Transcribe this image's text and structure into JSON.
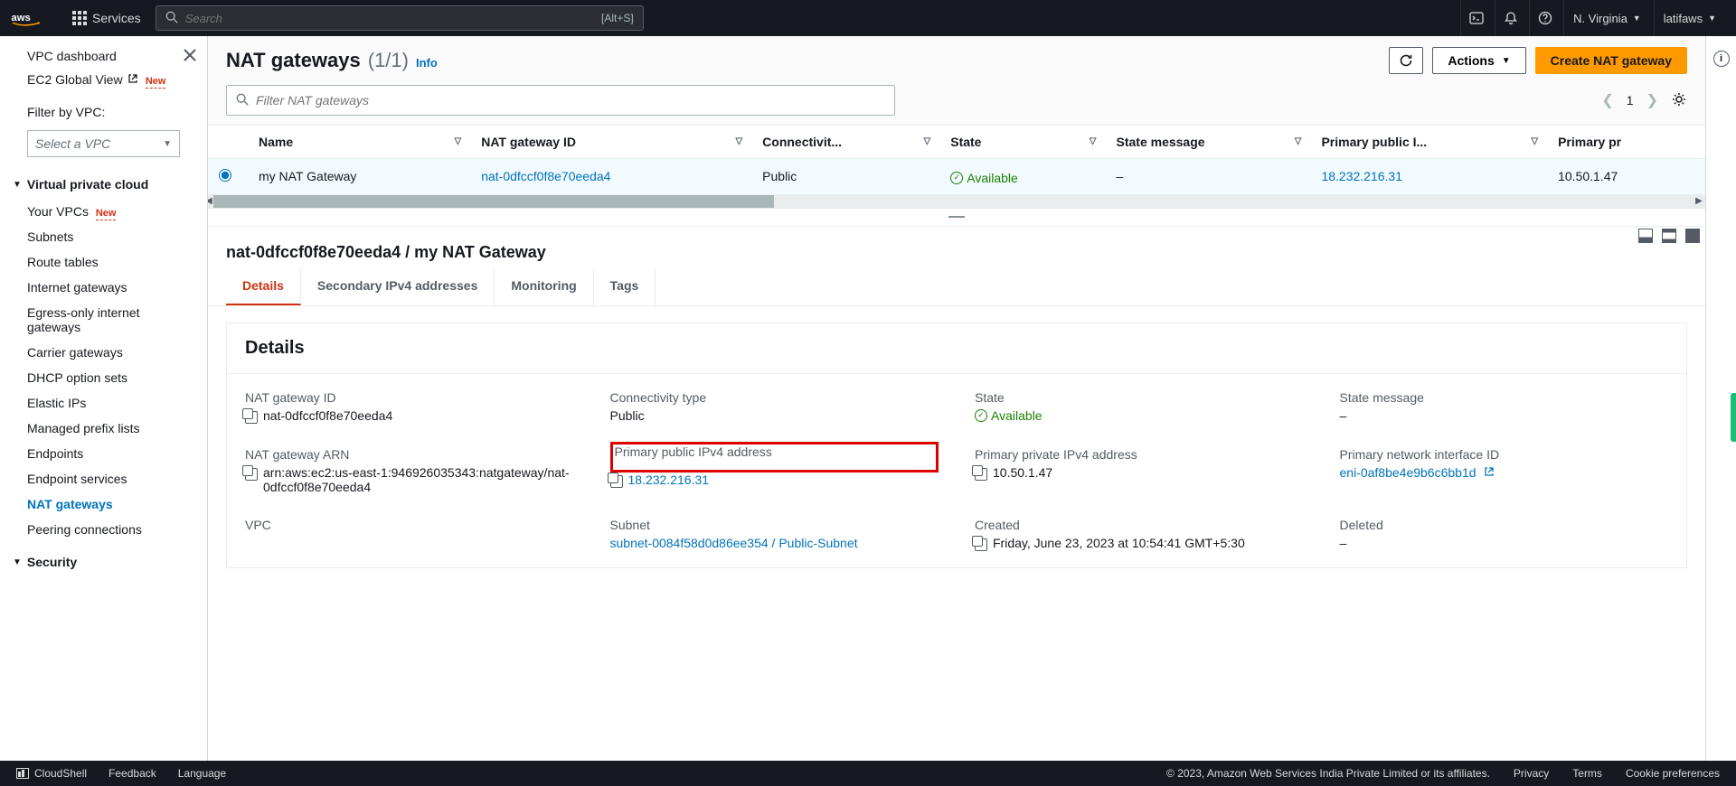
{
  "topbar": {
    "services": "Services",
    "search_placeholder": "Search",
    "search_kbd": "[Alt+S]",
    "region": "N. Virginia",
    "user": "latifaws"
  },
  "sidebar": {
    "dashboard": "VPC dashboard",
    "ec2_global": "EC2 Global View",
    "new_badge": "New",
    "filter_label": "Filter by VPC:",
    "select_vpc": "Select a VPC",
    "section1": "Virtual private cloud",
    "items1": [
      "Your VPCs",
      "Subnets",
      "Route tables",
      "Internet gateways",
      "Egress-only internet gateways",
      "Carrier gateways",
      "DHCP option sets",
      "Elastic IPs",
      "Managed prefix lists",
      "Endpoints",
      "Endpoint services",
      "NAT gateways",
      "Peering connections"
    ],
    "section2": "Security"
  },
  "page": {
    "title": "NAT gateways",
    "count": "(1/1)",
    "info": "Info",
    "actions": "Actions",
    "create": "Create NAT gateway",
    "filter_placeholder": "Filter NAT gateways",
    "page_num": "1"
  },
  "table": {
    "cols": [
      "Name",
      "NAT gateway ID",
      "Connectivit...",
      "State",
      "State message",
      "Primary public I...",
      "Primary pr"
    ],
    "row": {
      "name": "my NAT Gateway",
      "id": "nat-0dfccf0f8e70eeda4",
      "conn": "Public",
      "state": "Available",
      "msg": "–",
      "pub_ip": "18.232.216.31",
      "priv_ip": "10.50.1.47"
    }
  },
  "details": {
    "breadcrumb": "nat-0dfccf0f8e70eeda4 / my NAT Gateway",
    "tabs": [
      "Details",
      "Secondary IPv4 addresses",
      "Monitoring",
      "Tags"
    ],
    "heading": "Details",
    "f": {
      "nat_id_l": "NAT gateway ID",
      "nat_id_v": "nat-0dfccf0f8e70eeda4",
      "conn_l": "Connectivity type",
      "conn_v": "Public",
      "state_l": "State",
      "state_v": "Available",
      "msg_l": "State message",
      "msg_v": "–",
      "arn_l": "NAT gateway ARN",
      "arn_v": "arn:aws:ec2:us-east-1:946926035343:natgateway/nat-0dfccf0f8e70eeda4",
      "pub_l": "Primary public IPv4 address",
      "pub_v": "18.232.216.31",
      "priv_l": "Primary private IPv4 address",
      "priv_v": "10.50.1.47",
      "eni_l": "Primary network interface ID",
      "eni_v": "eni-0af8be4e9b6c6bb1d",
      "vpc_l": "VPC",
      "subnet_l": "Subnet",
      "subnet_v": "subnet-0084f58d0d86ee354 / Public-Subnet",
      "created_l": "Created",
      "created_v": "Friday, June 23, 2023 at 10:54:41 GMT+5:30",
      "deleted_l": "Deleted",
      "deleted_v": "–"
    }
  },
  "footer": {
    "cloudshell": "CloudShell",
    "feedback": "Feedback",
    "language": "Language",
    "copyright": "© 2023, Amazon Web Services India Private Limited or its affiliates.",
    "privacy": "Privacy",
    "terms": "Terms",
    "cookie": "Cookie preferences"
  }
}
